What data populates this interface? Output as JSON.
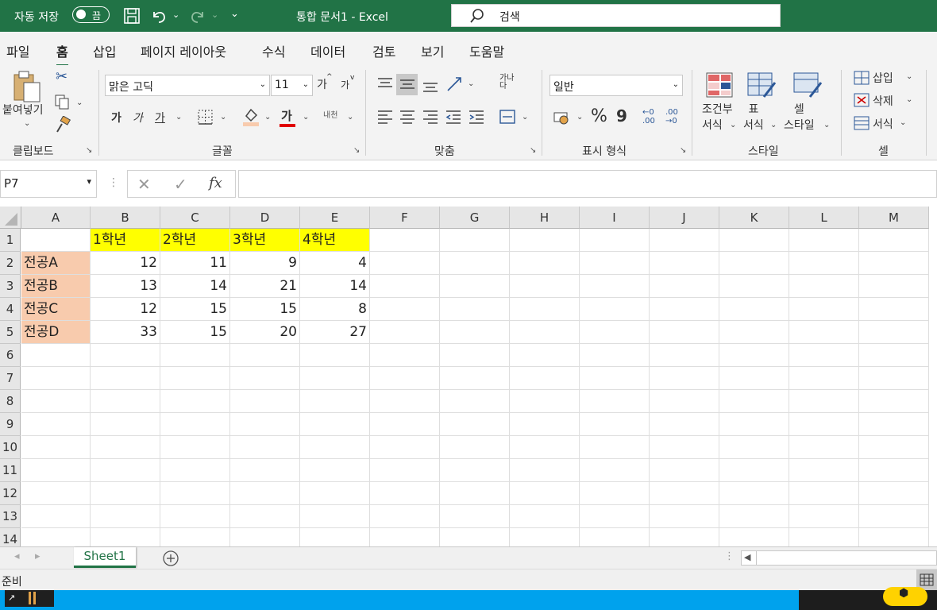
{
  "titlebar": {
    "autosave_label": "자동 저장",
    "toggle_state": "끔",
    "doc_title": "통합 문서1  -  Excel",
    "search_placeholder": "검색"
  },
  "menu_tabs": [
    "파일",
    "홈",
    "삽입",
    "페이지 레이아웃",
    "수식",
    "데이터",
    "검토",
    "보기",
    "도움말"
  ],
  "active_tab": "홈",
  "ribbon": {
    "clipboard": {
      "label": "클립보드",
      "paste": "붙여넣기"
    },
    "font": {
      "label": "글꼴",
      "font_name": "맑은 고딕",
      "font_size": "11",
      "grow": "가",
      "shrink": "가",
      "bold": "가",
      "italic": "가",
      "underline": "가",
      "font_color_letter": "가",
      "phonetic": "내천"
    },
    "alignment": {
      "label": "맞춤",
      "wrap": "가나\n다"
    },
    "number": {
      "label": "표시 형식",
      "format": "일반",
      "percent": "%",
      "comma": "9",
      "inc_dec": "←0\n.00",
      "dec_dec": ".00\n→0"
    },
    "styles": {
      "label": "스타일",
      "conditional": "조건부\n서식",
      "table": "표\n서식",
      "cell": "셀\n스타일"
    },
    "cells": {
      "label": "셀",
      "insert": "삽입",
      "delete": "삭제",
      "format": "서식"
    }
  },
  "formula_bar": {
    "name_box": "P7",
    "formula": ""
  },
  "columns": [
    "A",
    "B",
    "C",
    "D",
    "E",
    "F",
    "G",
    "H",
    "I",
    "J",
    "K",
    "L",
    "M"
  ],
  "rows": [
    "1",
    "2",
    "3",
    "4",
    "5",
    "6",
    "7",
    "8",
    "9",
    "10",
    "11",
    "12",
    "13",
    "14"
  ],
  "cells": {
    "B1": "1학년",
    "C1": "2학년",
    "D1": "3학년",
    "E1": "4학년",
    "A2": "전공A",
    "B2": "12",
    "C2": "11",
    "D2": "9",
    "E2": "4",
    "A3": "전공B",
    "B3": "13",
    "C3": "14",
    "D3": "21",
    "E3": "14",
    "A4": "전공C",
    "B4": "12",
    "C4": "15",
    "D4": "15",
    "E4": "8",
    "A5": "전공D",
    "B5": "33",
    "C5": "15",
    "D5": "20",
    "E5": "27"
  },
  "colors": {
    "header_fill": "#ffff00",
    "label_fill": "#f8cbad",
    "accent": "#217346"
  },
  "sheet_tab": "Sheet1",
  "status": "준비"
}
